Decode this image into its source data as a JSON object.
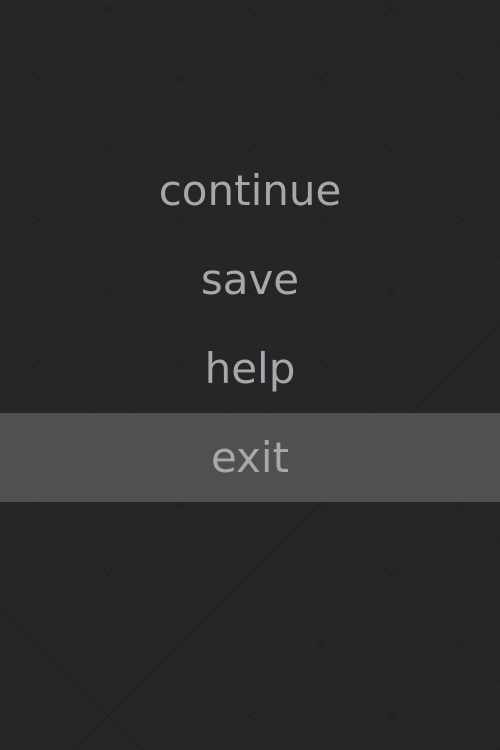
{
  "menu": {
    "items": [
      {
        "label": "continue",
        "selected": false
      },
      {
        "label": "save",
        "selected": false
      },
      {
        "label": "help",
        "selected": false
      },
      {
        "label": "exit",
        "selected": true
      }
    ]
  },
  "colors": {
    "background": "#272528",
    "text": "#a9a7aa",
    "highlight": "#505050"
  }
}
